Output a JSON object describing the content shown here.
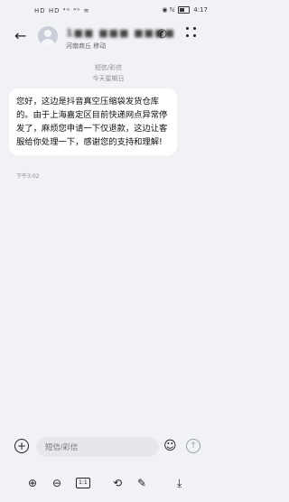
{
  "status_bar": {
    "left_icons": "HD HD ⁴ᴳ ⁴ᴳ ≋",
    "right_icons": "◉ ℕ",
    "time": "4:17"
  },
  "header": {
    "back_icon": "back-arrow-icon",
    "contact_number": "1■■ ■■■ ■■■■",
    "contact_location": "河南商丘 移动",
    "call_icon": "phone-icon",
    "more_icon": "more-vertical-icon"
  },
  "thread": {
    "channel_label": "短信/彩信",
    "day_label": "今天星期日",
    "messages": [
      {
        "text": "您好，这边是抖音真空压缩袋发货仓库的。由于上海嘉定区目前快递网点异常停发了，麻烦您申请一下仅退款，这边让客服给你处理一下，感谢您的支持和理解!",
        "time": "下午3:02"
      }
    ]
  },
  "composer": {
    "placeholder": "短信/彩信",
    "plus_icon": "add-circle-icon",
    "emoji_icon": "emoji-icon",
    "send_icon": "send-icon"
  },
  "toolbar": {
    "actual_size_label": "1:1",
    "items": [
      "zoom-in-icon",
      "zoom-out-icon",
      "actual-size-icon",
      "rotate-icon",
      "edit-icon",
      "download-icon"
    ]
  }
}
